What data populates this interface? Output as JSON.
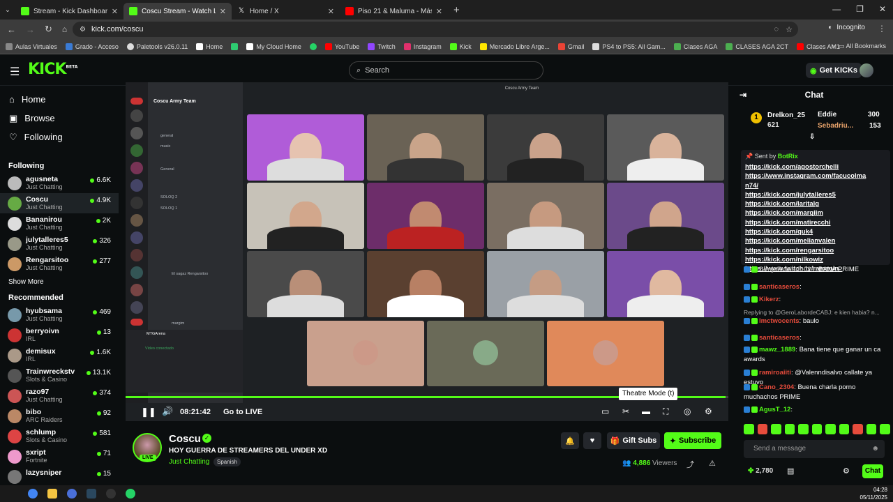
{
  "browser": {
    "tabs": [
      {
        "label": "Stream - Kick Dashboard",
        "color": "#53fc18"
      },
      {
        "label": "Coscu Stream - Watch Live",
        "color": "#53fc18"
      },
      {
        "label": "Home / X",
        "color": "#ffffff"
      },
      {
        "label": "Piso 21 & Maluma - Más De La...",
        "color": "#ff0000"
      }
    ],
    "url": "kick.com/coscu",
    "incognito": "Incognito",
    "bookmarks": [
      {
        "label": "Aulas Virtuales",
        "color": "#888"
      },
      {
        "label": "Grado - Acceso",
        "color": "#3a7bd5"
      },
      {
        "label": "Paletools v26.0.11",
        "color": "#ddd"
      },
      {
        "label": "Home",
        "color": "#fff"
      },
      {
        "label": "",
        "color": "#2ecc71"
      },
      {
        "label": "My Cloud Home",
        "color": "#fff"
      },
      {
        "label": "",
        "color": "#25d366"
      },
      {
        "label": "YouTube",
        "color": "#ff0000"
      },
      {
        "label": "Twitch",
        "color": "#9146ff"
      },
      {
        "label": "Instagram",
        "color": "#e1306c"
      },
      {
        "label": "Kick",
        "color": "#53fc18"
      },
      {
        "label": "Mercado Libre Arge...",
        "color": "#ffe600"
      },
      {
        "label": "Gmail",
        "color": "#ea4335"
      },
      {
        "label": "PS4 to PS5: All Gam...",
        "color": "#ddd"
      },
      {
        "label": "Clases AGA",
        "color": "#4caf50"
      },
      {
        "label": "CLASES AGA 2CT",
        "color": "#4caf50"
      },
      {
        "label": "Clases AM1",
        "color": "#ff0000"
      }
    ],
    "all_bookmarks": "All Bookmarks"
  },
  "header": {
    "logo": "KICK",
    "logo_tag": "BETA",
    "search_placeholder": "Search",
    "get_kicks": "Get KICKs"
  },
  "sidebar": {
    "nav": [
      {
        "label": "Home",
        "icon": "home-icon"
      },
      {
        "label": "Browse",
        "icon": "browse-icon"
      },
      {
        "label": "Following",
        "icon": "heart-icon"
      }
    ],
    "following_header": "Following",
    "following": [
      {
        "name": "agusneta",
        "category": "Just Chatting",
        "viewers": "6.6K",
        "color": "#bbb"
      },
      {
        "name": "Coscu",
        "category": "Just Chatting",
        "viewers": "4.9K",
        "color": "#6a4"
      },
      {
        "name": "Bananirou",
        "category": "Just Chatting",
        "viewers": "2K",
        "color": "#ddd"
      },
      {
        "name": "julytalleres5",
        "category": "Just Chatting",
        "viewers": "326",
        "color": "#998"
      },
      {
        "name": "Rengarsitoo",
        "category": "Just Chatting",
        "viewers": "277",
        "color": "#c96"
      }
    ],
    "show_more": "Show More",
    "recommended_header": "Recommended",
    "recommended": [
      {
        "name": "hyubsama",
        "category": "Just Chatting",
        "viewers": "469",
        "color": "#79a"
      },
      {
        "name": "berryoivn",
        "category": "IRL",
        "viewers": "13",
        "color": "#c33"
      },
      {
        "name": "demisux",
        "category": "IRL",
        "viewers": "1.6K",
        "color": "#a98"
      },
      {
        "name": "Trainwreckstv",
        "category": "Slots & Casino",
        "viewers": "13.1K",
        "color": "#555"
      },
      {
        "name": "razo97",
        "category": "Just Chatting",
        "viewers": "374",
        "color": "#c55"
      },
      {
        "name": "bibo",
        "category": "ARC Raiders",
        "viewers": "92",
        "color": "#b86"
      },
      {
        "name": "schlump",
        "category": "Slots & Casino",
        "viewers": "581",
        "color": "#d44"
      },
      {
        "name": "sxript",
        "category": "Fortnite",
        "viewers": "71",
        "color": "#e9c"
      },
      {
        "name": "lazysniper",
        "category": "",
        "viewers": "15",
        "color": "#777"
      }
    ]
  },
  "video": {
    "discord_server": "Coscu Army Team",
    "discord_window_title": "Coscu Army Team",
    "discord_lines": [
      "general",
      "music",
      "General",
      "SOLOQ 2",
      "SOLOQ 1",
      "El sagaz Rengarsitoo",
      "margim",
      "MTGArena",
      "Video conectado"
    ],
    "time": "08:21:42",
    "go_live": "Go to LIVE",
    "progress": 0.995,
    "tooltip": "Theatre Mode (t)"
  },
  "stream": {
    "name": "Coscu",
    "live": "LIVE",
    "title": "HOY GUERRA DE STREAMERS DEL UNDER XD",
    "category": "Just Chatting",
    "language": "Spanish",
    "gift_subs": "Gift Subs",
    "subscribe": "Subscribe",
    "viewers": "4,886",
    "viewers_label": "Viewers"
  },
  "chat": {
    "title": "Chat",
    "gifters": [
      {
        "rank": "1",
        "name": "Drelkon_25",
        "count": "621"
      },
      {
        "name": "Eddie",
        "count": "300"
      },
      {
        "name": "Sebadriu...",
        "count": "153"
      }
    ],
    "pinned_by": "Sent by",
    "pinned_bot": "BotRix",
    "pinned_links": [
      "https://kick.com/agostorchelli",
      "https://www.instagram.com/facucolma",
      "n74/",
      "https://kick.com/julytalleres5",
      "https://kick.com/laritalg",
      "https://kick.com/margiim",
      "https://kick.com/matirecchi",
      "https://kick.com/quk4",
      "https://kick.com/melianvalen",
      "https://kick.com/rengarsitoo",
      "https://kick.com/nilkowiz",
      "https://www.twitch.tv/ramanin_"
    ],
    "messages": [
      {
        "user": "BenjaRobledo024",
        "text": "BANA PRIME",
        "color": "#aaa"
      },
      {
        "user": "santicaseros",
        "text": "",
        "color": "#e74c3c"
      },
      {
        "user": "Kikerz",
        "text": "",
        "color": "#e74c3c"
      },
      {
        "user": "",
        "text": "Replying to @GeroLabordeCABJ: e kien habia? n...",
        "color": "#aaa"
      },
      {
        "user": "lmctwocents",
        "text": "baulo",
        "color": "#e74c3c"
      },
      {
        "user": "santicaseros",
        "text": "",
        "color": "#e74c3c"
      },
      {
        "user": "mawz_1889",
        "text": "Bana tiene que ganar un ca awards",
        "color": "#53fc18"
      },
      {
        "user": "ramiroaiiti",
        "text": "@Valenndisalvo callate ya estuvo",
        "color": "#e74c3c"
      },
      {
        "user": "Cano_2304",
        "text": "Buena charla porno muchachos PRIME",
        "color": "#e74c3c"
      },
      {
        "user": "AgusT_12",
        "text": "",
        "color": "#53fc18"
      }
    ],
    "input_placeholder": "Send a message",
    "points": "2,780",
    "chat_button": "Chat"
  },
  "taskbar": {
    "time": "04:28",
    "date": "05/11/2025"
  }
}
